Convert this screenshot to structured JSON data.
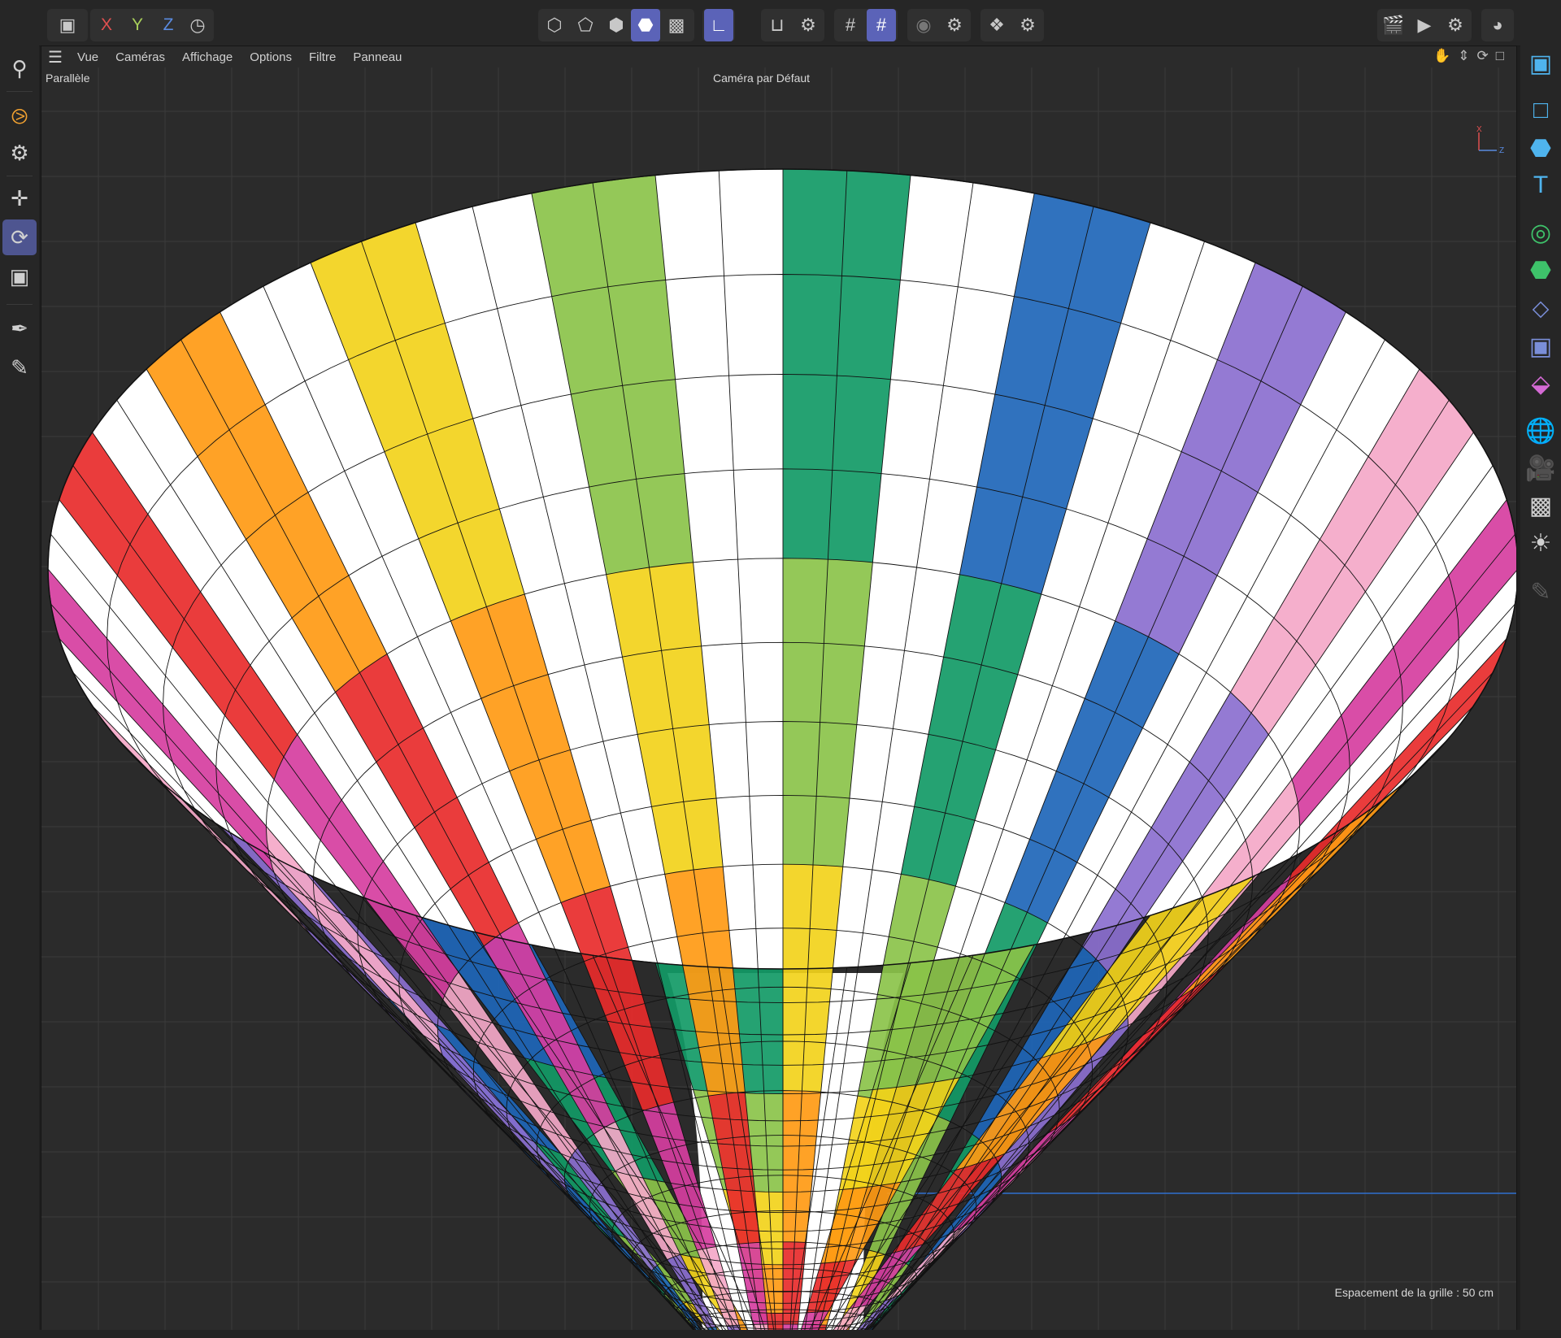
{
  "toolbar": {
    "axis_x": "X",
    "axis_y": "Y",
    "axis_z": "Z"
  },
  "viewport": {
    "menu": [
      "Vue",
      "Caméras",
      "Affichage",
      "Options",
      "Filtre",
      "Panneau"
    ],
    "projection_label": "Parallèle",
    "camera_label": "Caméra par Défaut",
    "grid_spacing_label": "Espacement de la grille : 50 cm",
    "gizmo_x": "X",
    "gizmo_z": "Z"
  },
  "colors": {
    "ui_bg": "#262626",
    "viewport_bg": "#2b2b2b",
    "active_tool": "#5b63b8",
    "axis_x": "#e05050",
    "axis_y": "#a8cf5a",
    "axis_z": "#5a8be0",
    "object_icon": "#4fb4ee"
  },
  "icons": {
    "top": [
      "cinema4d-icon",
      "model-mode-icon",
      "points-mode-icon",
      "edges-mode-icon",
      "polygons-mode-icon",
      "uv-mode-icon",
      "axis-mode-icon",
      "snap-icon",
      "snap-settings-icon",
      "workplane-icon",
      "grid-snap-icon",
      "solo-icon",
      "solo-settings-icon",
      "symmetry-icon",
      "symmetry-settings-icon",
      "render-region-icon",
      "render-view-icon",
      "render-settings-icon",
      "picture-viewer-icon"
    ],
    "left": [
      "search-icon",
      "live-selection-icon",
      "selection-settings-icon",
      "move-icon",
      "rotate-icon",
      "scale-icon",
      "spline-pen-icon",
      "sketch-icon"
    ],
    "right": [
      "object-manager-icon",
      "null-object-icon",
      "cube-object-icon",
      "text-object-icon",
      "deformer-icon",
      "generator-icon",
      "fields-icon",
      "effector-icon",
      "volume-icon",
      "environment-icon",
      "camera-icon",
      "render-icon",
      "light-icon",
      "layer-icon"
    ]
  }
}
